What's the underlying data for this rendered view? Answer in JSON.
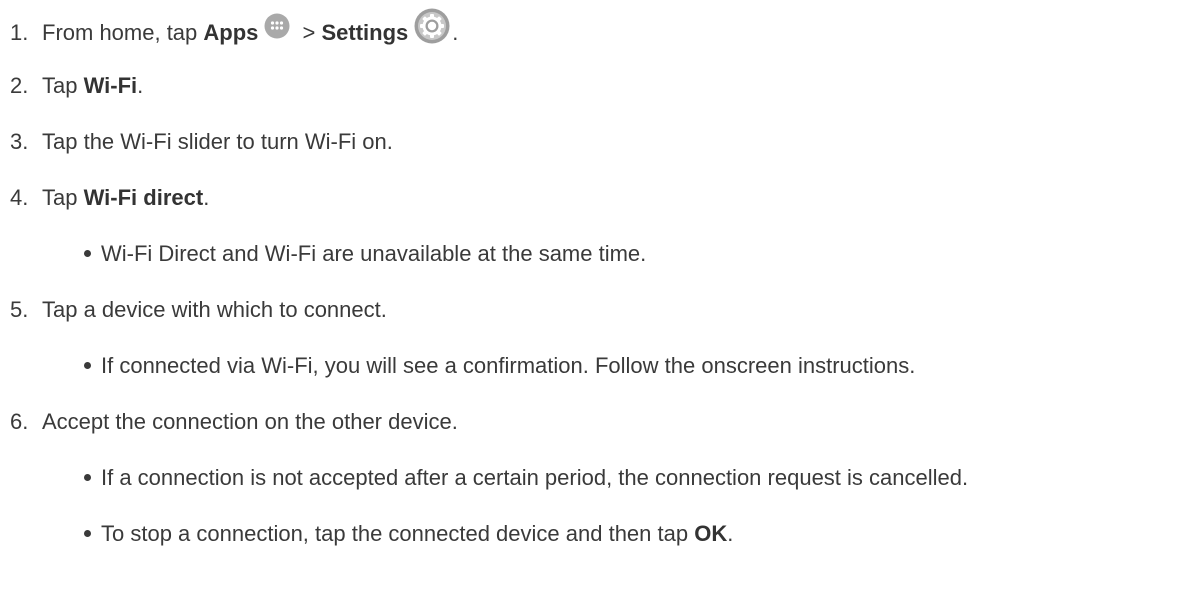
{
  "steps": [
    {
      "number": "1.",
      "text_a": "From home, tap ",
      "bold_a": "Apps",
      "icon_a": "apps-icon",
      "text_b": " > ",
      "bold_b": "Settings",
      "icon_b": "settings-icon",
      "text_c": "."
    },
    {
      "number": "2.",
      "text_a": "Tap ",
      "bold_a": "Wi-Fi",
      "text_b": "."
    },
    {
      "number": "3.",
      "text_a": "Tap the Wi-Fi slider to turn Wi-Fi on."
    },
    {
      "number": "4.",
      "text_a": "Tap ",
      "bold_a": "Wi-Fi direct",
      "text_b": "."
    },
    {
      "number": "5.",
      "text_a": "Tap a device with which to connect."
    },
    {
      "number": "6.",
      "text_a": "Accept the connection on the other device."
    }
  ],
  "bullets": [
    {
      "text_a": "Wi-Fi Direct and Wi-Fi are unavailable at the same time."
    },
    {
      "text_a": "If connected via Wi-Fi, you will see a confirmation. Follow the onscreen instructions."
    },
    {
      "text_a": "If a connection is not accepted after a certain period, the connection request is cancelled."
    },
    {
      "text_a": "To stop a connection, tap the connected device and then tap ",
      "bold_a": "OK",
      "text_b": "."
    }
  ],
  "colors": {
    "text": "#3a3a3a",
    "icon_circle": "#a9a9a9",
    "icon_ring": "#8f8f8f"
  }
}
